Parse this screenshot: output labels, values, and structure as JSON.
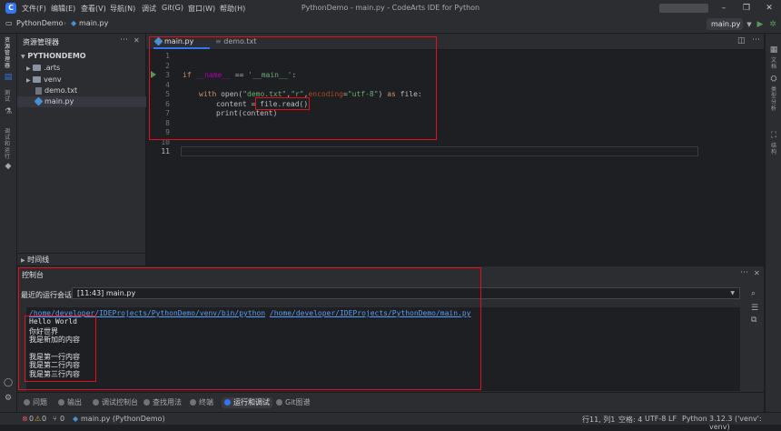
{
  "app": {
    "title": "PythonDemo - main.py - CodeArts IDE for Python"
  },
  "menu": [
    "文件(F)",
    "编辑(E)",
    "查看(V)",
    "导航(N)",
    "调试",
    "Git(G)",
    "窗口(W)",
    "帮助(H)"
  ],
  "breadcrumb": {
    "project": "PythonDemo",
    "file": "main.py"
  },
  "run_config": "main.py",
  "left_strip": {
    "explorer": "资源管理器",
    "test": "测试",
    "debug": "调试和运行"
  },
  "right_strip": {
    "a": "文档",
    "b": "类型分析",
    "c": "结构"
  },
  "project_panel": {
    "title": "资源管理器",
    "root": "PYTHONDEMO",
    "items": [
      ".arts",
      "venv",
      "demo.txt",
      "main.py"
    ],
    "timeline": "时间线"
  },
  "editor": {
    "tabs": [
      "main.py",
      "demo.txt"
    ],
    "line_numbers": [
      "1",
      "2",
      "3",
      "4",
      "5",
      "6",
      "7",
      "8",
      "9",
      "10",
      "11"
    ],
    "code": {
      "l3_if": "if ",
      "l3_name": "__name__",
      "l3_eq": " == ",
      "l3_main": "'__main__'",
      "l3_colon": ":",
      "l5_with": "with ",
      "l5_open": "open(",
      "l5_s1": "\"demo.txt\"",
      "l5_c1": ",",
      "l5_s2": "\"r\"",
      "l5_c2": ",",
      "l5_enc": "encoding",
      "l5_eq": "=",
      "l5_s3": "\"utf-8\"",
      "l5_close": ") ",
      "l5_as": "as",
      "l5_rest": " file:",
      "l6_a": "content = ",
      "l6_b": "file.read()",
      "l7": "print(content)"
    }
  },
  "console": {
    "title": "控制台",
    "session_label": "最近的运行会话",
    "session_value": "[11:43] main.py",
    "command_python": "/home/developer/IDEProjects/PythonDemo/venv/bin/python",
    "command_script": "/home/developer/IDEProjects/PythonDemo/main.py",
    "output": [
      "Hello World",
      "你好世界",
      "我是新加的内容",
      "",
      "我是第一行内容",
      "我是第二行内容",
      "我是第三行内容"
    ]
  },
  "bottom_tabs": [
    "问题",
    "输出",
    "调试控制台",
    "查找用法",
    "终端",
    "运行和调试",
    "Git图谱"
  ],
  "status": {
    "errors": "0",
    "warnings": "0",
    "git": "0",
    "file": "main.py (PythonDemo)",
    "position": "行11, 列1",
    "indent": "空格: 4",
    "encoding": "UTF-8",
    "eol": "LF",
    "language": "Python",
    "interpreter": "3.12.3 ('venv': venv)"
  },
  "colors": {
    "accent": "#3574f0",
    "highlight_box": "#e0101e",
    "run_green": "#57965c"
  }
}
